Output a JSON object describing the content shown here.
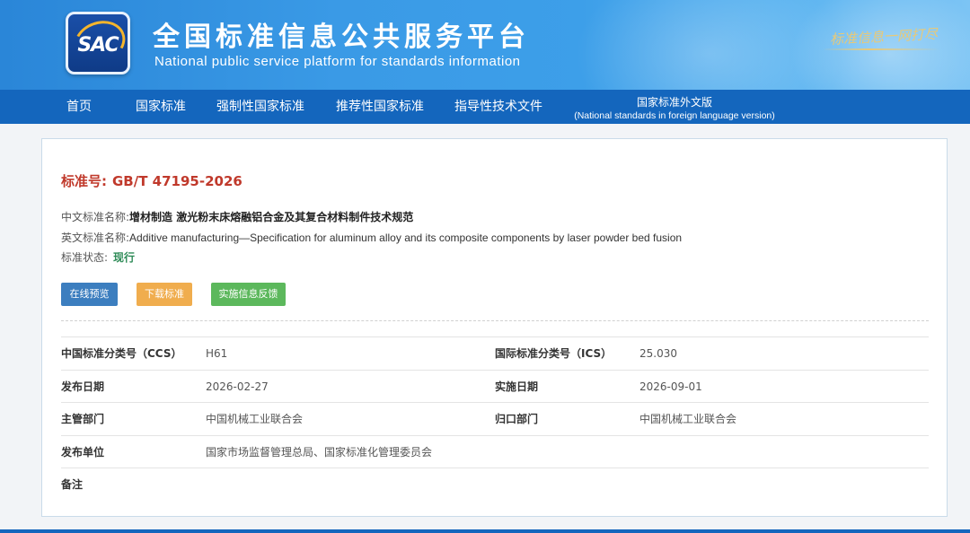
{
  "header": {
    "logo_text": "SAC",
    "title": "全国标准信息公共服务平台",
    "subtitle": "National public service platform  for standards information",
    "slogan": "标准信息一网打尽"
  },
  "nav": {
    "items": [
      {
        "label": "首页"
      },
      {
        "label": "国家标准"
      },
      {
        "label": "强制性国家标准"
      },
      {
        "label": "推荐性国家标准"
      },
      {
        "label": "指导性技术文件"
      }
    ],
    "foreign": {
      "label_cn": "国家标准外文版",
      "label_en": "(National standards in foreign language version)"
    }
  },
  "standard": {
    "number_label": "标准号:",
    "number": "GB/T 47195-2026",
    "cn_name_label": "中文标准名称:",
    "cn_name": "增材制造 激光粉末床熔融铝合金及其复合材料制件技术规范",
    "en_name_label": "英文标准名称:",
    "en_name": "Additive manufacturing—Specification for aluminum alloy and its composite components by laser powder bed fusion",
    "status_label": "标准状态:",
    "status": "现行"
  },
  "buttons": {
    "preview": "在线预览",
    "download": "下载标准",
    "feedback": "实施信息反馈"
  },
  "details": {
    "ccs_label": "中国标准分类号（CCS）",
    "ccs": "H61",
    "ics_label": "国际标准分类号（ICS）",
    "ics": "25.030",
    "publish_date_label": "发布日期",
    "publish_date": "2026-02-27",
    "impl_date_label": "实施日期",
    "impl_date": "2026-09-01",
    "dept_label": "主管部门",
    "dept": "中国机械工业联合会",
    "tc_label": "归口部门",
    "tc": "中国机械工业联合会",
    "issuer_label": "发布单位",
    "issuer": "国家市场监督管理总局、国家标准化管理委员会",
    "remark_label": "备注"
  },
  "colors": {
    "header_blue": "#3a9ae6",
    "nav_blue": "#1466bd",
    "std_no_red": "#c0392b",
    "status_green": "#2e8b57",
    "btn_blue": "#3c7ebf",
    "btn_orange": "#f0ad4e",
    "btn_green": "#5cb85c"
  }
}
